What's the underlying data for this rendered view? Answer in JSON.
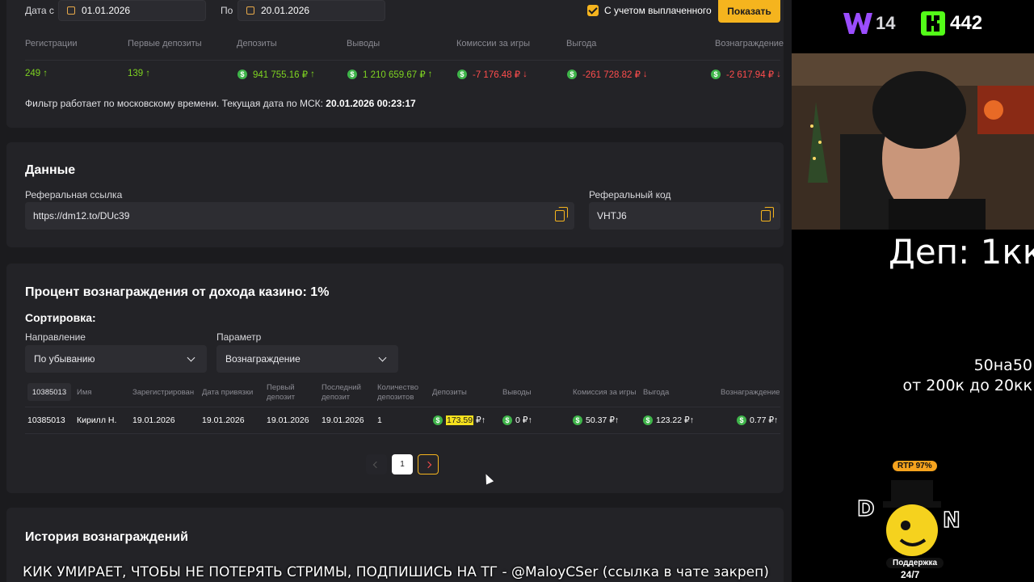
{
  "filters": {
    "date_from_label": "Дата с",
    "date_from": "01.01.2026",
    "date_to_label": "По",
    "date_to": "20.01.2026",
    "include_paid_label": "С учетом выплаченного",
    "show_button": "Показать"
  },
  "stats": {
    "headers": [
      "Регистрации",
      "Первые депозиты",
      "Депозиты",
      "Выводы",
      "Комиссии за игры",
      "Выгода",
      "Вознаграждение"
    ],
    "values": [
      "249",
      "139",
      "941 755.16 ₽",
      "1 210 659.67 ₽",
      "-7 176.48 ₽",
      "-261 728.82 ₽",
      "-2 617.94 ₽"
    ],
    "trends": [
      "↑",
      "↑",
      "↑",
      "↑",
      "↓",
      "↓",
      "↓"
    ],
    "note_prefix": "Фильтр работает по московскому времени. Текущая дата по МСК: ",
    "note_date": "20.01.2026 00:23:17"
  },
  "data_section": {
    "title": "Данные",
    "ref_link_label": "Реферальная ссылка",
    "ref_link": "https://dm12.to/DUc39",
    "ref_code_label": "Реферальный код",
    "ref_code": "VHTJ6"
  },
  "reward_section": {
    "title": "Процент вознаграждения от дохода казино: 1%",
    "sort_title": "Сортировка:",
    "direction_label": "Направление",
    "direction_value": "По убыванию",
    "param_label": "Параметр",
    "param_value": "Вознаграждение"
  },
  "table": {
    "id_filter": "10385013",
    "headers": {
      "name": "Имя",
      "registered": "Зарегистрирован",
      "bind_date": "Дата привязки",
      "first_dep_1": "Первый",
      "first_dep_2": "депозит",
      "last_dep_1": "Последний",
      "last_dep_2": "депозит",
      "count_1": "Количество",
      "count_2": "депозитов",
      "deposits": "Депозиты",
      "withdrawals": "Выводы",
      "commission": "Комиссия за игры",
      "profit": "Выгода",
      "reward": "Вознаграждение"
    },
    "row": {
      "id": "10385013",
      "name": "Кирилл Н.",
      "registered": "19.01.2026",
      "bind_date": "19.01.2026",
      "first_dep": "19.01.2026",
      "last_dep": "19.01.2026",
      "count": "1",
      "deposits": "173.59",
      "withdrawals": "0 ₽",
      "commission": "50.37 ₽",
      "profit": "123.22 ₽",
      "reward": "0.77 ₽"
    }
  },
  "pagination": {
    "current": "1"
  },
  "history_title": "История вознаграждений",
  "overlay": {
    "w_count": "14",
    "k_count": "442",
    "dep_text": "Деп: 1кк",
    "side_line1": "50на50",
    "side_line2": "от 200к до 20кк",
    "ticker": "КИК УМИРАЕТ, ЧТОБЫ НЕ ПОТЕРЯТЬ СТРИМЫ, ПОДПИШИСЬ НА ТГ - @MaloyCSer (ссылка в чате закреп)",
    "promo_rtp": "RTP 97%",
    "promo_support": "Поддержка",
    "promo_247": "24/7"
  },
  "colors": {
    "accent": "#f5b41e",
    "positive": "#7ed321",
    "negative": "#ff4d4d",
    "bg": "#1b1b1e",
    "card": "#232327"
  }
}
